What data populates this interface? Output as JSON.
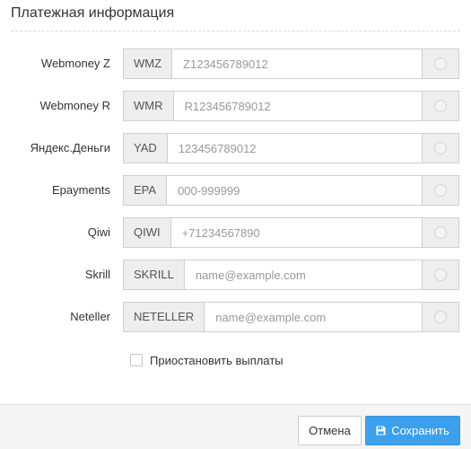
{
  "dialog": {
    "title": "Платежная информация"
  },
  "payment_fields": [
    {
      "label": "Webmoney Z",
      "addon": "WMZ",
      "placeholder": "Z123456789012",
      "value": ""
    },
    {
      "label": "Webmoney R",
      "addon": "WMR",
      "placeholder": "R123456789012",
      "value": ""
    },
    {
      "label": "Яндекс.Деньги",
      "addon": "YAD",
      "placeholder": "123456789012",
      "value": ""
    },
    {
      "label": "Epayments",
      "addon": "EPA",
      "placeholder": "000-999999",
      "value": ""
    },
    {
      "label": "Qiwi",
      "addon": "QIWI",
      "placeholder": "+71234567890",
      "value": ""
    },
    {
      "label": "Skrill",
      "addon": "SKRILL",
      "placeholder": "name@example.com",
      "value": ""
    },
    {
      "label": "Neteller",
      "addon": "NETELLER",
      "placeholder": "name@example.com",
      "value": ""
    }
  ],
  "pause_payouts": {
    "label": "Приостановить выплаты",
    "checked": false
  },
  "footer": {
    "cancel_label": "Отмена",
    "save_label": "Сохранить",
    "save_icon": "floppy-disk-icon"
  },
  "colors": {
    "primary": "#3da0ec",
    "addon_bg": "#eeeeee",
    "footer_bg": "#f5f5f5"
  }
}
